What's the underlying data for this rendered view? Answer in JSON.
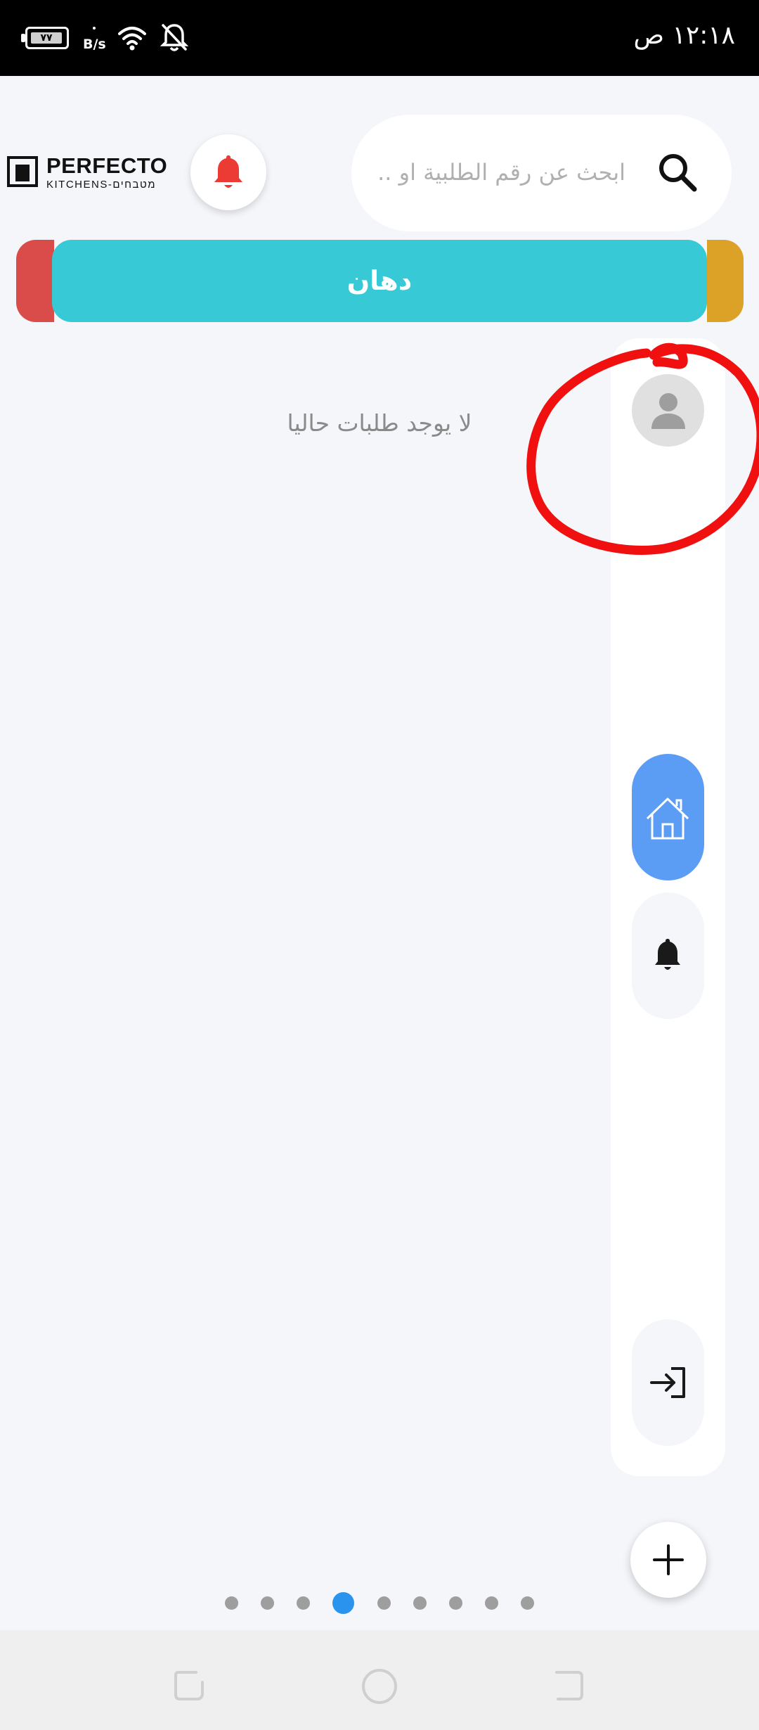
{
  "status_bar": {
    "battery_level": "٧٧",
    "network_speed_unit": "B/s",
    "time": "١٢:١٨ ص",
    "icons": [
      "battery-icon",
      "wifi-icon",
      "notifications-off-icon"
    ]
  },
  "header": {
    "logo_title": "PERFECTO",
    "logo_subtitle": "KITCHENS-מטבחים",
    "search_placeholder": "ابحث عن رقم الطلبية او ...",
    "bell_color": "#ec3b35"
  },
  "category_tabs": {
    "active_label": "دهان",
    "colors": {
      "left": "#d94c4a",
      "active": "#38c9d6",
      "right": "#dba227"
    }
  },
  "main": {
    "empty_message": "لا يوجد طلبات حاليا"
  },
  "side_rail": {
    "items": [
      "avatar",
      "home-icon",
      "bell-icon",
      "logout-icon"
    ],
    "active_item": "home-icon",
    "active_color": "#5b9cf5"
  },
  "pagination": {
    "total": 9,
    "active_index": 3,
    "active_color": "#2a93ee"
  },
  "annotation": {
    "color": "#f01010"
  }
}
